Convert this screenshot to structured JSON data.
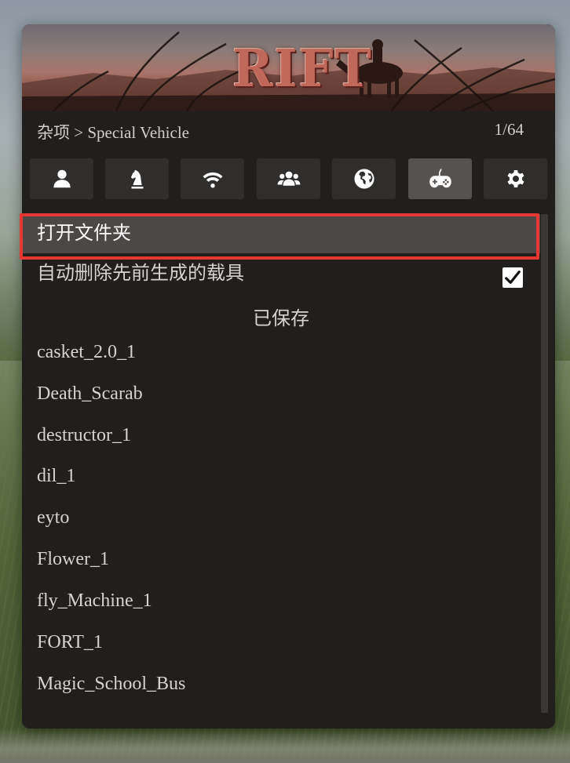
{
  "banner": {
    "logo_text": "RIFT"
  },
  "header": {
    "breadcrumb": "杂项 > Special Vehicle",
    "page_counter": "1/64"
  },
  "tabs": [
    {
      "icon": "person-icon",
      "active": false
    },
    {
      "icon": "chess-knight-icon",
      "active": false
    },
    {
      "icon": "wifi-icon",
      "active": false
    },
    {
      "icon": "group-icon",
      "active": false
    },
    {
      "icon": "globe-icon",
      "active": false
    },
    {
      "icon": "gamepad-icon",
      "active": true
    },
    {
      "icon": "gear-icon",
      "active": false
    }
  ],
  "menu": {
    "open_folder": "打开文件夹",
    "auto_delete": "自动删除先前生成的载具",
    "auto_delete_checked": true,
    "saved_header": "已保存",
    "saved_items": [
      "casket_2.0_1",
      "Death_Scarab",
      "destructor_1",
      "dil_1",
      "eyto",
      "Flower_1",
      "fly_Machine_1",
      "FORT_1",
      "Magic_School_Bus"
    ]
  },
  "colors": {
    "panel_bg": "#211f1d",
    "tab_bg": "#302e2c",
    "tab_active_bg": "#55524f",
    "selected_row_bg": "#4b4846",
    "highlight": "#e63732",
    "text": "#d6d3ce"
  }
}
